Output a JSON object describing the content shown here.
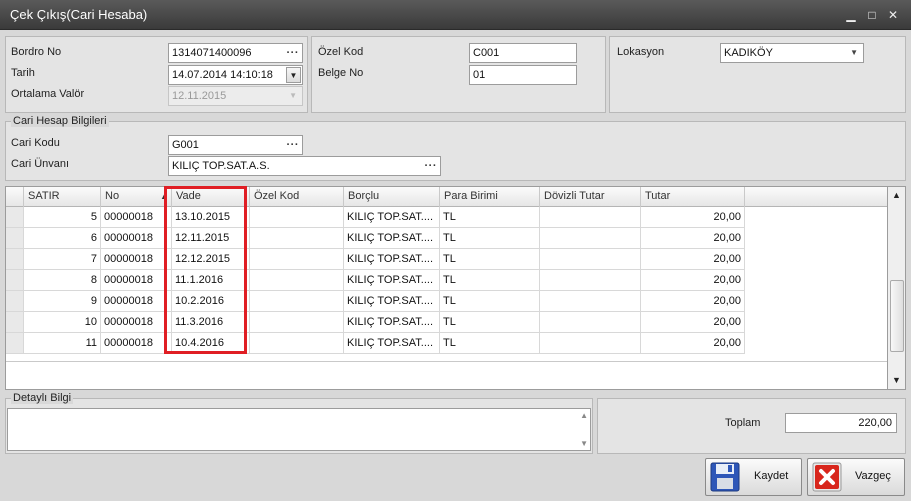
{
  "window": {
    "title": "Çek Çıkış(Cari Hesaba)",
    "controls": {
      "minimize": "▁",
      "maximize": "□",
      "close": "✕"
    }
  },
  "form": {
    "bordro_no": {
      "label": "Bordro No",
      "value": "1314071400096"
    },
    "tarih": {
      "label": "Tarih",
      "value": "14.07.2014 14:10:18"
    },
    "ortalama_valor": {
      "label": "Ortalama Valör",
      "value": "12.11.2015"
    },
    "ozel_kod": {
      "label": "Özel Kod",
      "value": "C001"
    },
    "belge_no": {
      "label": "Belge No",
      "value": "01"
    },
    "lokasyon": {
      "label": "Lokasyon",
      "value": "KADIKÖY"
    }
  },
  "cari": {
    "group_title": "Cari Hesap Bilgileri",
    "kodu": {
      "label": "Cari Kodu",
      "value": "G001"
    },
    "unvani": {
      "label": "Cari Ünvanı",
      "value": "KILIÇ TOP.SAT.A.S."
    }
  },
  "grid": {
    "columns": [
      "SATIR",
      "No",
      "Vade",
      "Özel Kod",
      "Borçlu",
      "Para Birimi",
      "Dövizli Tutar",
      "Tutar"
    ],
    "sort_indicator": "▲",
    "rows": [
      {
        "satir": "5",
        "no": "00000018",
        "vade": "13.10.2015",
        "ozel_kod": "",
        "borclu": "KILIÇ TOP.SAT....",
        "para_birimi": "TL",
        "dovizli_tutar": "",
        "tutar": "20,00"
      },
      {
        "satir": "6",
        "no": "00000018",
        "vade": "12.11.2015",
        "ozel_kod": "",
        "borclu": "KILIÇ TOP.SAT....",
        "para_birimi": "TL",
        "dovizli_tutar": "",
        "tutar": "20,00"
      },
      {
        "satir": "7",
        "no": "00000018",
        "vade": "12.12.2015",
        "ozel_kod": "",
        "borclu": "KILIÇ TOP.SAT....",
        "para_birimi": "TL",
        "dovizli_tutar": "",
        "tutar": "20,00"
      },
      {
        "satir": "8",
        "no": "00000018",
        "vade": "11.1.2016",
        "ozel_kod": "",
        "borclu": "KILIÇ TOP.SAT....",
        "para_birimi": "TL",
        "dovizli_tutar": "",
        "tutar": "20,00"
      },
      {
        "satir": "9",
        "no": "00000018",
        "vade": "10.2.2016",
        "ozel_kod": "",
        "borclu": "KILIÇ TOP.SAT....",
        "para_birimi": "TL",
        "dovizli_tutar": "",
        "tutar": "20,00"
      },
      {
        "satir": "10",
        "no": "00000018",
        "vade": "11.3.2016",
        "ozel_kod": "",
        "borclu": "KILIÇ TOP.SAT....",
        "para_birimi": "TL",
        "dovizli_tutar": "",
        "tutar": "20,00"
      },
      {
        "satir": "11",
        "no": "00000018",
        "vade": "10.4.2016",
        "ozel_kod": "",
        "borclu": "KILIÇ TOP.SAT....",
        "para_birimi": "TL",
        "dovizli_tutar": "",
        "tutar": "20,00"
      }
    ]
  },
  "detayli_bilgi": {
    "group_title": "Detaylı Bilgi",
    "value": ""
  },
  "toplam": {
    "label": "Toplam",
    "value": "220,00"
  },
  "buttons": {
    "kaydet": "Kaydet",
    "vazgec": "Vazgeç"
  },
  "colors": {
    "highlight": "#e01e24",
    "title_bar": "#4a4a4a"
  }
}
